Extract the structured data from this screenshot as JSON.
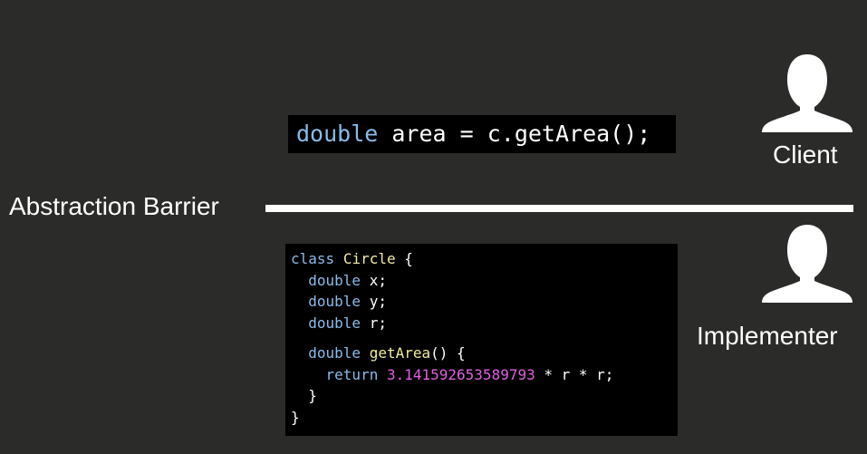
{
  "client_code": {
    "keyword": "double",
    "rest": " area = c.getArea();"
  },
  "abstraction_label": "Abstraction Barrier",
  "client_label": "Client",
  "implementer_label": "Implementer",
  "impl_code": {
    "line1_kw": "class",
    "line1_name": "Circle",
    "line1_rest": " {",
    "field_type": "double",
    "field_x": " x;",
    "field_y": " y;",
    "field_r": " r;",
    "method_type": "double",
    "method_name": "getArea",
    "method_rest": "() {",
    "return_kw": "return",
    "return_num": "3.141592653589793",
    "return_rest": " * r * r;",
    "close_method": "}",
    "close_class": "}"
  },
  "colors": {
    "background": "#2b2b29",
    "keyword": "#8bbbe8",
    "function": "#f2eca0",
    "number": "#e060e0"
  },
  "icons": [
    "person-icon",
    "person-icon"
  ]
}
